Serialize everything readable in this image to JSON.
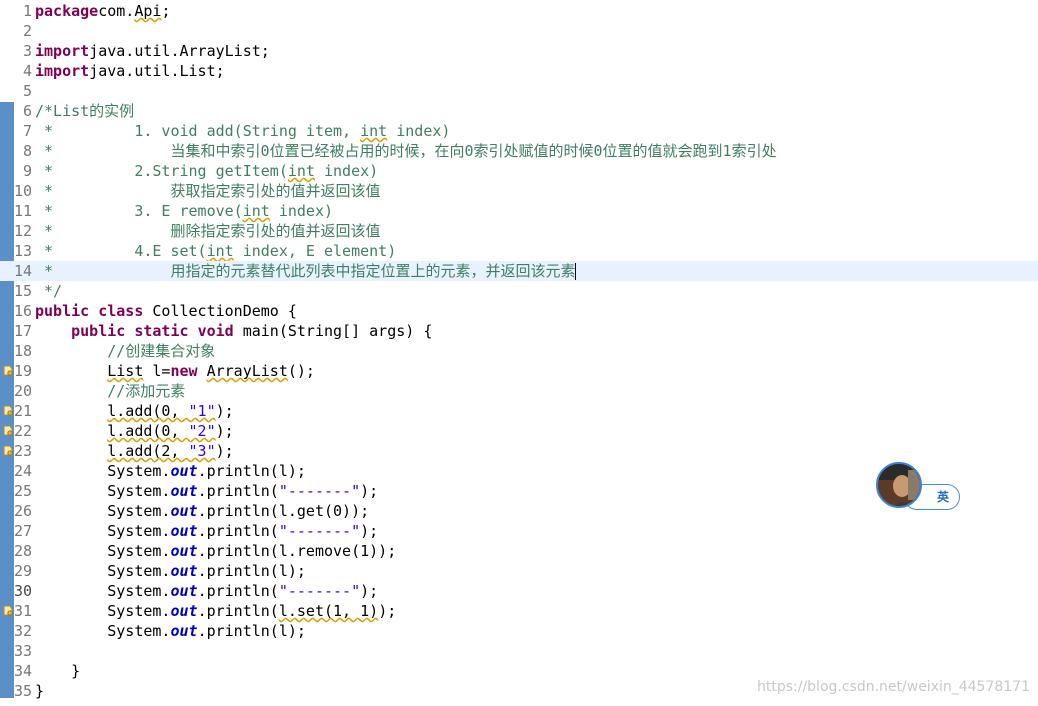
{
  "editor": {
    "lines": [
      {
        "n": "1",
        "tokens": [
          [
            "kw",
            "package"
          ],
          [
            "",
            "com."
          ],
          [
            "wavy",
            "Api"
          ],
          [
            "",
            ";"
          ]
        ]
      },
      {
        "n": "2",
        "tokens": []
      },
      {
        "n": "3",
        "tokens": [
          [
            "kw",
            "import"
          ],
          [
            "",
            "java.util.ArrayList;"
          ]
        ]
      },
      {
        "n": "4",
        "tokens": [
          [
            "kw",
            "import"
          ],
          [
            "",
            "java.util.List;"
          ]
        ]
      },
      {
        "n": "5",
        "tokens": []
      },
      {
        "n": "6",
        "tokens": [
          [
            "cm",
            "/*List的实例"
          ]
        ]
      },
      {
        "n": "7",
        "tokens": [
          [
            "cm",
            " *         1. void add(String item, "
          ],
          [
            "cm wavy",
            "int"
          ],
          [
            "cm",
            " index)"
          ]
        ]
      },
      {
        "n": "8",
        "tokens": [
          [
            "cm",
            " *             当集和中索引0位置已经被占用的时候，在向0索引处赋值的时候0位置的值就会跑到1索引处"
          ]
        ]
      },
      {
        "n": "9",
        "tokens": [
          [
            "cm",
            " *         2.String getItem("
          ],
          [
            "cm wavy",
            "int"
          ],
          [
            "cm",
            " index)"
          ]
        ]
      },
      {
        "n": "10",
        "tokens": [
          [
            "cm",
            " *             获取指定索引处的值并返回该值"
          ]
        ]
      },
      {
        "n": "11",
        "tokens": [
          [
            "cm",
            " *         3. E remove("
          ],
          [
            "cm wavy",
            "int"
          ],
          [
            "cm",
            " index)"
          ]
        ]
      },
      {
        "n": "12",
        "tokens": [
          [
            "cm",
            " *             删除指定索引处的值并返回该值"
          ]
        ]
      },
      {
        "n": "13",
        "tokens": [
          [
            "cm",
            " *         4.E set("
          ],
          [
            "cm wavy",
            "int"
          ],
          [
            "cm",
            " index, E element)"
          ]
        ]
      },
      {
        "n": "14",
        "tokens": [
          [
            "cm",
            " *             用指定的元素替代此列表中指定位置上的元素，并返回该元素"
          ]
        ],
        "current": true
      },
      {
        "n": "15",
        "tokens": [
          [
            "cm",
            " */"
          ]
        ]
      },
      {
        "n": "16",
        "tokens": [
          [
            "kw",
            "public"
          ],
          [
            "",
            " "
          ],
          [
            "kw",
            "class"
          ],
          [
            "",
            " CollectionDemo {"
          ]
        ]
      },
      {
        "n": "17",
        "tokens": [
          [
            "",
            "    "
          ],
          [
            "kw",
            "public"
          ],
          [
            "",
            " "
          ],
          [
            "kw",
            "static"
          ],
          [
            "",
            " "
          ],
          [
            "kw",
            "void"
          ],
          [
            "",
            " main(String[] args) {"
          ]
        ]
      },
      {
        "n": "18",
        "tokens": [
          [
            "cm",
            "        //创建集合对象"
          ]
        ]
      },
      {
        "n": "19",
        "tokens": [
          [
            "",
            "        "
          ],
          [
            "wavy",
            "List"
          ],
          [
            "",
            " l="
          ],
          [
            "kw",
            "new"
          ],
          [
            "",
            " "
          ],
          [
            "wavy",
            "ArrayList"
          ],
          [
            "",
            "();"
          ]
        ],
        "marker": true
      },
      {
        "n": "20",
        "tokens": [
          [
            "cm",
            "        //添加元素"
          ]
        ]
      },
      {
        "n": "21",
        "tokens": [
          [
            "",
            "        "
          ],
          [
            "wavy",
            "l.add(0, "
          ],
          [
            "str wavy",
            "\"1\""
          ],
          [
            "",
            ");"
          ]
        ],
        "marker": true
      },
      {
        "n": "22",
        "tokens": [
          [
            "",
            "        "
          ],
          [
            "wavy",
            "l.add(0, "
          ],
          [
            "str wavy",
            "\"2\""
          ],
          [
            "",
            ");"
          ]
        ],
        "marker": true
      },
      {
        "n": "23",
        "tokens": [
          [
            "",
            "        "
          ],
          [
            "wavy",
            "l.add(2, "
          ],
          [
            "str wavy",
            "\"3\""
          ],
          [
            "",
            ");"
          ]
        ],
        "marker": true
      },
      {
        "n": "24",
        "tokens": [
          [
            "",
            "        System."
          ],
          [
            "fld",
            "out"
          ],
          [
            "",
            ".println(l);"
          ]
        ]
      },
      {
        "n": "25",
        "tokens": [
          [
            "",
            "        System."
          ],
          [
            "fld",
            "out"
          ],
          [
            "",
            ".println("
          ],
          [
            "str",
            "\"-------\""
          ],
          [
            "",
            ");"
          ]
        ]
      },
      {
        "n": "26",
        "tokens": [
          [
            "",
            "        System."
          ],
          [
            "fld",
            "out"
          ],
          [
            "",
            ".println(l.get(0));"
          ]
        ]
      },
      {
        "n": "27",
        "tokens": [
          [
            "",
            "        System."
          ],
          [
            "fld",
            "out"
          ],
          [
            "",
            ".println("
          ],
          [
            "str",
            "\"-------\""
          ],
          [
            "",
            ");"
          ]
        ]
      },
      {
        "n": "28",
        "tokens": [
          [
            "",
            "        System."
          ],
          [
            "fld",
            "out"
          ],
          [
            "",
            ".println(l.remove(1));"
          ]
        ]
      },
      {
        "n": "29",
        "tokens": [
          [
            "",
            "        System."
          ],
          [
            "fld",
            "out"
          ],
          [
            "",
            ".println(l);"
          ]
        ]
      },
      {
        "n": "30",
        "tokens": [
          [
            "",
            "        System."
          ],
          [
            "fld",
            "out"
          ],
          [
            "",
            ".println("
          ],
          [
            "str",
            "\"-------\""
          ],
          [
            "",
            ");"
          ]
        ],
        "hl": true
      },
      {
        "n": "31",
        "tokens": [
          [
            "",
            "        System."
          ],
          [
            "fld",
            "out"
          ],
          [
            "",
            ".println("
          ],
          [
            "wavy",
            "l.set(1, 1)"
          ],
          [
            "",
            ");"
          ]
        ],
        "marker": true
      },
      {
        "n": "32",
        "tokens": [
          [
            "",
            "        System."
          ],
          [
            "fld",
            "out"
          ],
          [
            "",
            ".println(l);"
          ]
        ]
      },
      {
        "n": "33",
        "tokens": []
      },
      {
        "n": "34",
        "tokens": [
          [
            "",
            "    }"
          ]
        ]
      },
      {
        "n": "35",
        "tokens": [
          [
            "",
            "}"
          ]
        ]
      }
    ]
  },
  "ime": {
    "label": "英"
  },
  "watermark": "https://blog.csdn.net/weixin_44578171"
}
